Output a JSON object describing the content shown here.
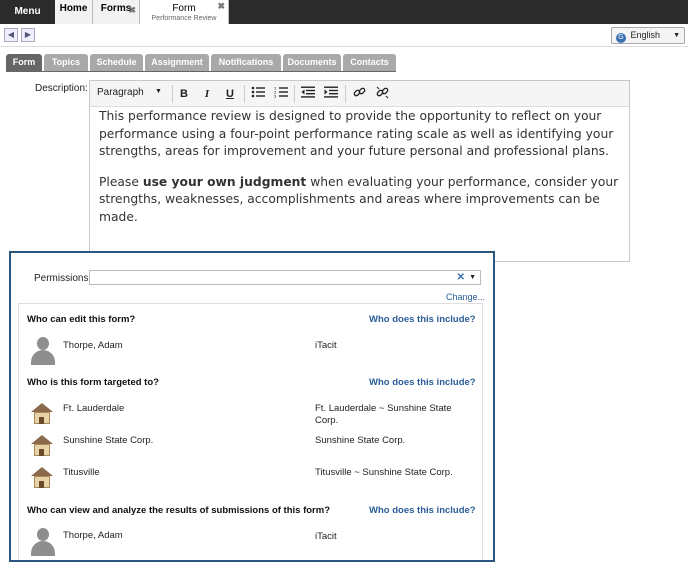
{
  "topbar": {
    "menu": "Menu",
    "home": "Home",
    "forms": "Forms",
    "form_title": "Form",
    "form_subtitle": "Performance Review",
    "close": "✖"
  },
  "navbar": {
    "back_icon": "◀",
    "forward_icon": "▶",
    "language": "English"
  },
  "tabs": [
    "Form",
    "Topics",
    "Schedule",
    "Assignment",
    "Notifications",
    "Documents",
    "Contacts"
  ],
  "description": {
    "label": "Description:",
    "toolbar": {
      "paragraph": "Paragraph",
      "bold": "B",
      "italic": "I",
      "underline": "U"
    },
    "para1": "This performance review is designed to provide the opportunity to reflect on your performance using a four-point performance rating scale as well as identifying your strengths, areas for improvement and your future personal and professional plans.",
    "para2_pre": "Please ",
    "para2_bold": "use your own judgment",
    "para2_post": " when evaluating your performance, consider your strengths, weaknesses, accomplishments and areas where improvements can be made."
  },
  "permissions": {
    "label": "Permissions:",
    "change": "Change...",
    "who_link": "Who does this include?",
    "sections": [
      {
        "title": "Who can edit this form?",
        "rows": [
          {
            "icon": "person-icon",
            "name": "Thorpe, Adam",
            "value": "iTacit"
          }
        ]
      },
      {
        "title": "Who is this form targeted to?",
        "rows": [
          {
            "icon": "location-icon",
            "name": "Ft. Lauderdale",
            "value": "Ft. Lauderdale ~ Sunshine State Corp."
          },
          {
            "icon": "location-icon",
            "name": "Sunshine State Corp.",
            "value": "Sunshine State Corp."
          },
          {
            "icon": "location-icon",
            "name": "Titusville",
            "value": "Titusville ~ Sunshine State Corp."
          }
        ]
      },
      {
        "title": "Who can view and analyze the results of submissions of this form?",
        "rows": [
          {
            "icon": "person-icon",
            "name": "Thorpe, Adam",
            "value": "iTacit"
          }
        ]
      }
    ]
  }
}
